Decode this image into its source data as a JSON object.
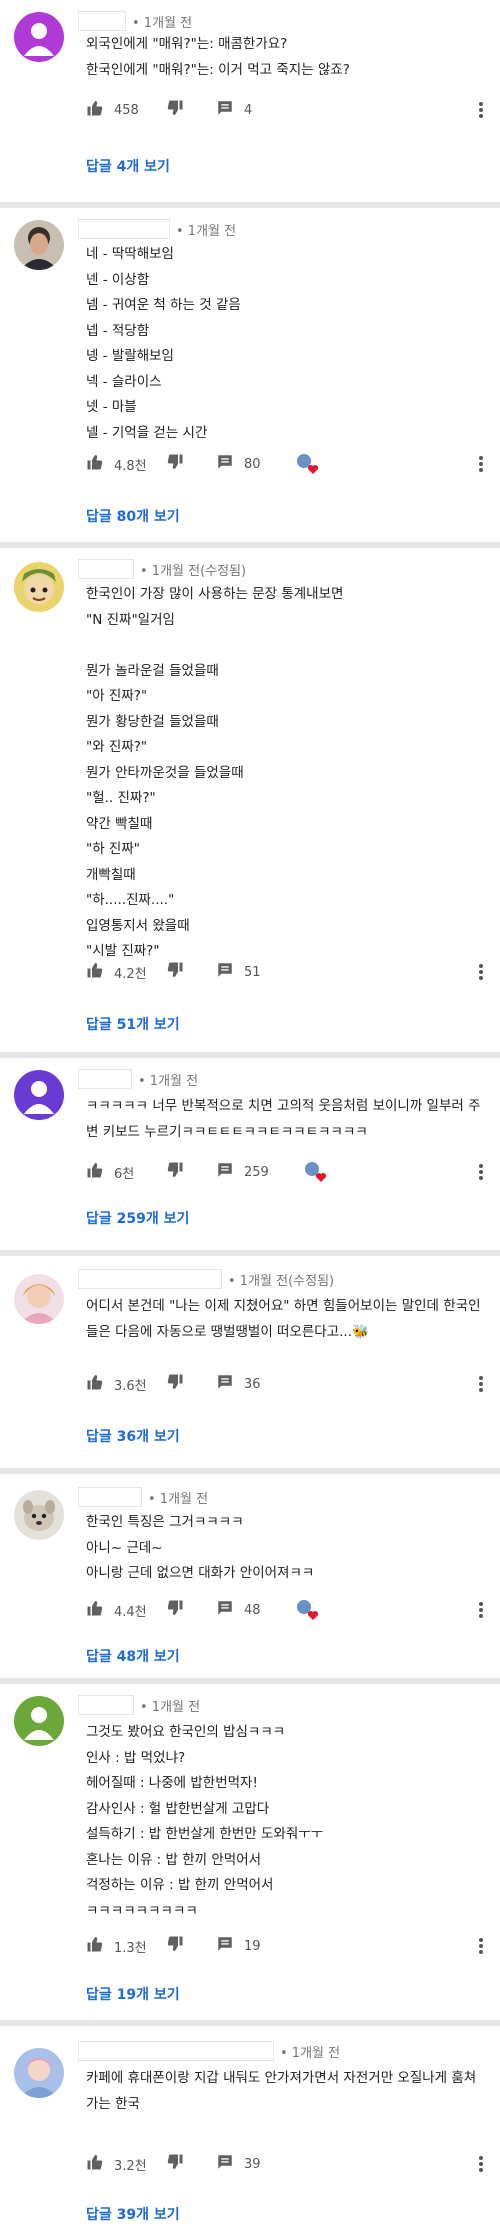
{
  "comments": [
    {
      "time": "• 1개월 전",
      "body": "외국인에게 \"매워?\"는: 매콤한가요?\n한국인에게 \"매워?\"는: 이거 먹고 죽지는 않죠?",
      "likes": "458",
      "replies": "4",
      "view_replies": "답글 4개 보기",
      "avatar": "purple-circle"
    },
    {
      "time": "• 1개월 전",
      "body": "네 - 딱딱해보임\n넨 - 이상함\n넴 - 귀여운 척 하는 것 같음\n넵 - 적당함\n넹 - 발랄해보임\n넥 - 슬라이스\n넷 - 마블\n넬 - 기억을 걷는 시간",
      "likes": "4.8천",
      "replies": "80",
      "view_replies": "답글 80개 보기",
      "avatar": "photo-man"
    },
    {
      "time": "• 1개월 전(수정됨)",
      "body": "한국인이 가장 많이 사용하는 문장 통계내보면\n\"N 진짜\"일거임\n\n뭔가 놀라운걸 들었을때\n\"아 진짜?\"\n뭔가 황당한걸 들었을때\n\"와 진짜?\"\n뭔가 안타까운것을 들었을때\n\"헐.. 진짜?\"\n약간 빡칠때\n\"하 진짜\"\n개빡칠때\n\"하.....진짜....\"\n입영통지서 왔을때\n\"시발 진짜?\"",
      "likes": "4.2천",
      "replies": "51",
      "view_replies": "답글 51개 보기",
      "avatar": "cartoon-green"
    },
    {
      "time": "• 1개월 전",
      "body": "ㅋㅋㅋㅋㅋ 너무 반복적으로 치면 고의적 웃음처럼 보이니까 일부러 주변 키보드 누르기ㅋㅋㅌㅌㅌㅋㅋㅌㅋㅋㅌㅋㅋㅋㅋ",
      "likes": "6천",
      "replies": "259",
      "view_replies": "답글 259개 보기",
      "avatar": "purple-circle"
    },
    {
      "time": "• 1개월 전(수정됨)",
      "body": "어디서 본건데 \"나는 이제 지쳤어요\" 하면 힘들어보이는 말인데 한국인들은 다음에 자동으로 땡벌땡벌이 떠오른다고...🐝",
      "likes": "3.6천",
      "replies": "36",
      "view_replies": "답글 36개 보기",
      "avatar": "photo-pink"
    },
    {
      "time": "• 1개월 전",
      "body": "한국인 특징은 그거ㅋㅋㅋㅋ\n아니~ 근데~\n아니랑 근데 없으면 대화가 안이어져ㅋㅋ",
      "likes": "4.4천",
      "replies": "48",
      "view_replies": "답글 48개 보기",
      "avatar": "photo-dog"
    },
    {
      "time": "• 1개월 전",
      "body": "그것도 봤어요 한국인의 밥심ㅋㅋㅋ\n인사 : 밥 먹었냐?\n헤어질때 : 나중에 밥한번먹자!\n감사인사 : 헐 밥한번살게 고맙다\n설득하기 : 밥 한번살게 한번만 도와줘ㅜㅜ\n혼나는 이유 : 밥 한끼 안먹어서\n걱정하는 이유 : 밥 한끼 안먹어서\nㅋㅋㅋㅋㅋㅋㅋㅋㅋ",
      "likes": "1.3천",
      "replies": "19",
      "view_replies": "답글 19개 보기",
      "avatar": "green-circle"
    },
    {
      "time": "• 1개월 전",
      "body": "카페에 휴대폰이랑 지갑 내둬도 안가져가면서 자전거만 오질나게 훔쳐가는 한국",
      "likes": "3.2천",
      "replies": "39",
      "view_replies": "답글 39개 보기",
      "avatar": "photo-blue"
    }
  ],
  "icons": {
    "like": "thumbs-up-icon",
    "dislike": "thumbs-down-icon",
    "reply": "reply-icon",
    "heart": "creator-heart-icon",
    "more": "more-vert-icon"
  },
  "colors": {
    "link": "#1e6bd8",
    "heart": "#e0182d",
    "divider": "#e6e6e6"
  }
}
